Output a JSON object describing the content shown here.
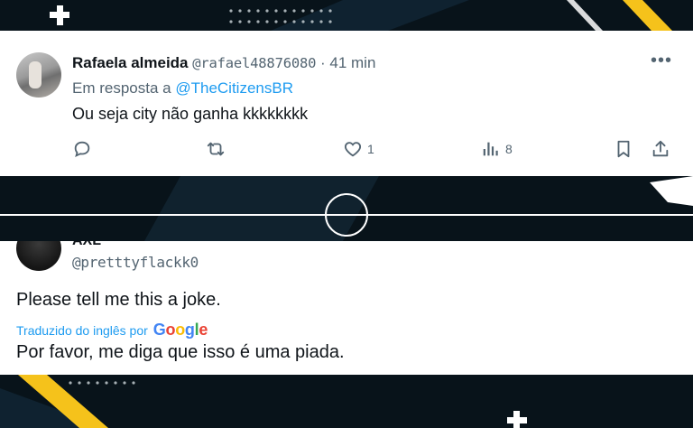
{
  "tweet1": {
    "author_name": "Rafaela almeida",
    "handle": "@rafael48876080",
    "separator": "·",
    "time": "41 min",
    "more_label": "•••",
    "reply_prefix": "Em resposta a",
    "reply_mention": "@TheCitizensBR",
    "text": "Ou seja city não ganha kkkkkkkk",
    "actions": {
      "reply_icon": "reply-icon",
      "retweet_icon": "retweet-icon",
      "like_icon": "heart-icon",
      "like_count": "1",
      "views_icon": "views-icon",
      "views_count": "8",
      "bookmark_icon": "bookmark-icon",
      "share_icon": "share-icon"
    }
  },
  "tweet2": {
    "author_name": "AXL",
    "handle": "@pretttyflackk0",
    "text": "Please tell me this a joke.",
    "translated_label": "Traduzido do inglês por",
    "google_logo": "Google",
    "translation": "Por favor, me diga que isso é uma piada."
  },
  "colors": {
    "accent": "#1d9bf0",
    "background": "#08131a",
    "stripe_yellow": "#f5c21b"
  }
}
